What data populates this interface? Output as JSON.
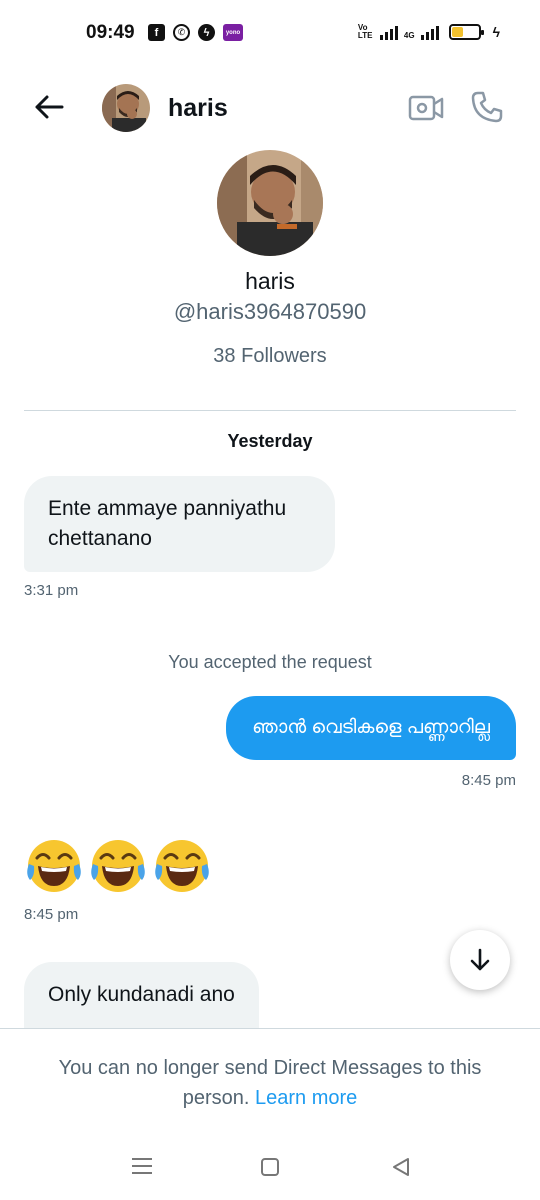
{
  "status_bar": {
    "time": "09:49",
    "network_left": "Vo LTE",
    "network_right": "4G",
    "battery_level": 0.4,
    "app_icons": [
      "facebook-icon",
      "whatsapp-icon",
      "messenger-icon",
      "yono-icon"
    ]
  },
  "header": {
    "name": "haris",
    "icons": [
      "back-arrow-icon",
      "video-call-icon",
      "phone-icon"
    ]
  },
  "profile": {
    "name": "haris",
    "handle": "@haris3964870590",
    "followers": "38 Followers"
  },
  "conversation": {
    "date_label": "Yesterday",
    "messages": [
      {
        "direction": "incoming",
        "text_line1": "Ente ammaye panniyathu",
        "text_line2": "chettanano",
        "time": "3:31 pm"
      },
      {
        "direction": "system",
        "text": "You accepted the request"
      },
      {
        "direction": "outgoing",
        "text": "ഞാൻ വെടികളെ പണ്ണാറില്ല",
        "time": "8:45 pm"
      },
      {
        "direction": "incoming",
        "emoji": "😂😂😂",
        "time": "8:45 pm"
      },
      {
        "direction": "incoming",
        "text": "Only kundanadi ano"
      }
    ]
  },
  "footer": {
    "notice": "You can no longer send Direct Messages to this person.",
    "learn_more": "Learn more"
  },
  "colors": {
    "accent": "#1d9bf0",
    "incoming_bubble": "#eff3f4",
    "secondary_text": "#536471"
  }
}
